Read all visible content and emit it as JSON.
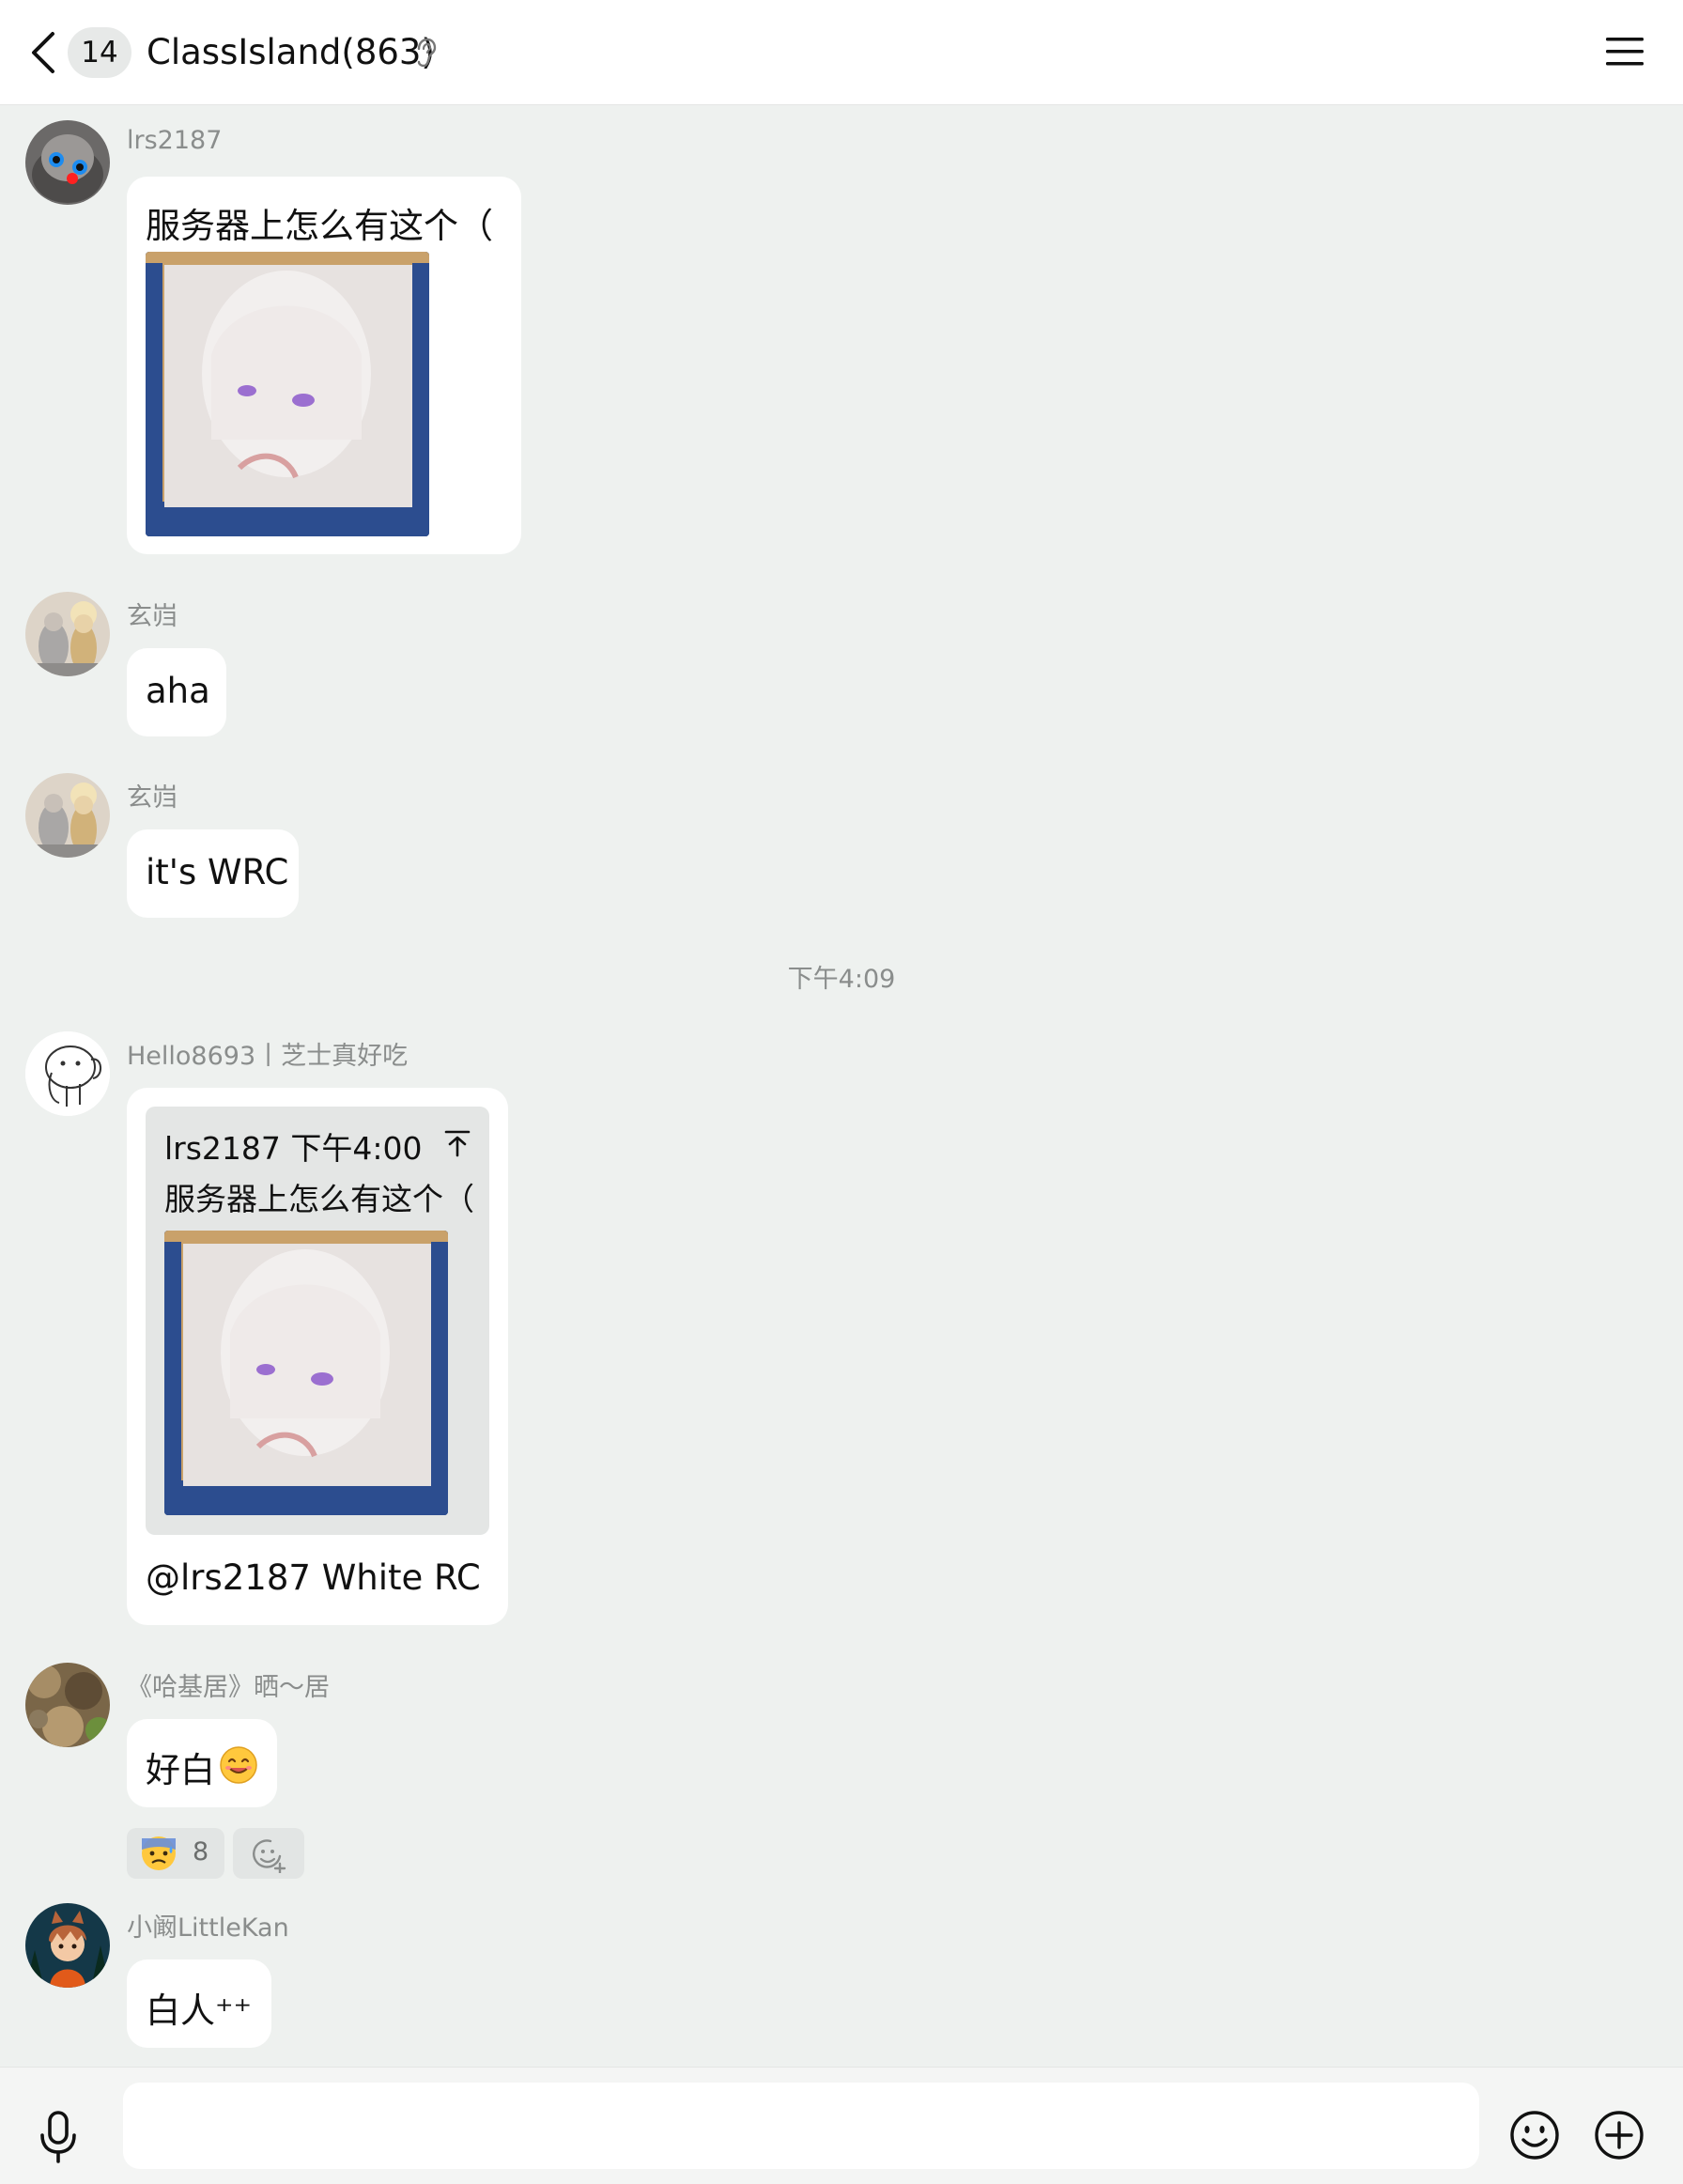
{
  "header": {
    "unread_count": "14",
    "title": "ClassIsland(863)"
  },
  "messages": [
    {
      "sender": "lrs2187",
      "text": "服务器上怎么有这个（"
    },
    {
      "sender": "玄岿",
      "text": "aha"
    },
    {
      "sender": "玄岿",
      "text": "it's WRC"
    },
    {
      "sender": "Hello8693丨芝士真好吃",
      "quote": {
        "meta": "lrs2187 下午4:00",
        "text": "服务器上怎么有这个（"
      },
      "text": "@lrs2187 White RC"
    },
    {
      "sender": "《哈基居》晒～居",
      "text": "好白",
      "reactions": [
        {
          "count": "8"
        }
      ]
    },
    {
      "sender": "小阚LittleKan",
      "text": "白人⁺⁺"
    }
  ],
  "timestamp": "下午4:09",
  "input": {
    "placeholder": ""
  },
  "colors": {
    "background": "#eef1ef",
    "bubble": "#ffffff",
    "header": "#ffffff",
    "muted_text": "#8a8d8c"
  },
  "icons": {
    "back": "chevron-left-icon",
    "listen": "ear-icon",
    "menu": "hamburger-menu-icon",
    "voice": "microphone-icon",
    "emoji": "smiley-icon",
    "more": "plus-circle-icon",
    "quote_jump": "arrow-top-icon",
    "add_reaction": "add-reaction-icon"
  }
}
